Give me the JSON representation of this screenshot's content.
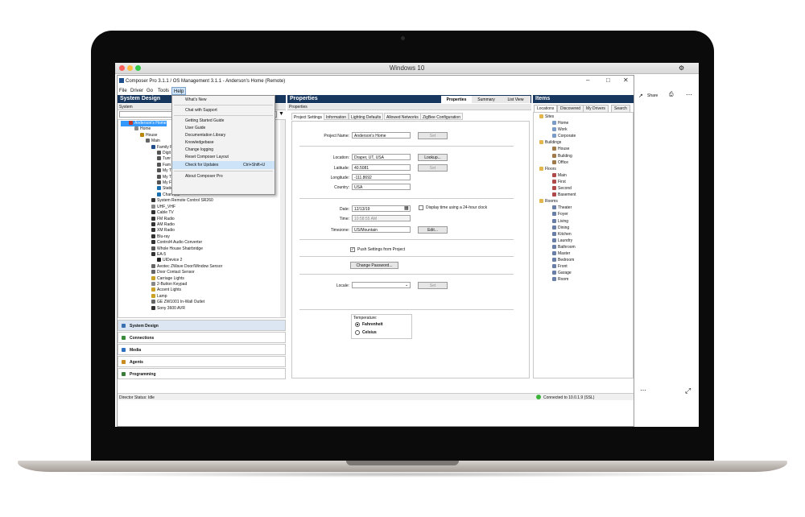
{
  "vm": {
    "title": "Windows 10",
    "toolbar": {
      "share": "Share"
    }
  },
  "app": {
    "title": "Composer Pro 3.1.1 / OS Management 3.1.1 - Anderson's Home (Remote)",
    "menu": [
      "File",
      "Driver",
      "Go",
      "Tools",
      "Help"
    ],
    "help_menu": {
      "items": [
        "What's New",
        "Chat with Support",
        "Getting Started Guide",
        "User Guide",
        "Documentation Library",
        "Knowledgebase",
        "Change logging",
        "Reset Composer Layout",
        "Check for Updates",
        "About Composer Pro"
      ],
      "shortcut": "Ctrl+Shift+U"
    },
    "system_design": {
      "title": "System Design",
      "subtitle": "System",
      "tree": [
        "Anderson's Home",
        "Home",
        "House",
        "Main",
        "Family R",
        "Digit",
        "Tunr",
        "Fam",
        "My T",
        "My T",
        "My F",
        "Stations",
        "Channels",
        "System Remote Control SR260",
        "UHF_VHF",
        "Cable TV",
        "FM Radio",
        "AM Radio",
        "XM Radio",
        "Blu-ray",
        "Control4 Audio Converter",
        "Whole House Shairbridge",
        "EA-5",
        "UIDevice 2",
        "Aeotec ZWave Door/Window Sensor",
        "Door Contact Sensor",
        "Carriage Lights",
        "2-Button Keypad",
        "Accent Lights",
        "Lamp",
        "GE ZW1001 In-Wall Outlet",
        "Sony 3600 AVR"
      ]
    },
    "nav": [
      "System Design",
      "Connections",
      "Media",
      "Agents",
      "Programming"
    ],
    "status": {
      "left": "Director Status: Idle",
      "right": "Connected to 10.0.1.9 (SSL)"
    },
    "properties": {
      "title": "Properties",
      "view_tabs": [
        "Properties",
        "Summary",
        "List View"
      ],
      "subtitle": "Properties",
      "tabs": [
        "Project Settings",
        "Information",
        "Lighting Defaults",
        "Allowed Networks",
        "ZigBee Configuration"
      ],
      "fields": {
        "project_name_label": "Project Name:",
        "project_name": "Anderson's Home",
        "set": "Set",
        "location_label": "Location:",
        "location": "Draper, UT, USA",
        "lookup": "Lookup...",
        "latitude_label": "Latitude:",
        "latitude": "40.5081",
        "longitude_label": "Longitude:",
        "longitude": "-111.8692",
        "country_label": "Country:",
        "country": "USA",
        "date_label": "Date:",
        "date": "12/13/19",
        "display24": "Display time using a 24-hour clock",
        "time_label": "Time:",
        "time": "10:58:55 AM",
        "timezone_label": "Timezone:",
        "timezone": "US/Mountain",
        "edit": "Edit...",
        "push": "Push Settings from Project",
        "change_password": "Change Password...",
        "locale_label": "Locale:",
        "temperature_label": "Temperature:",
        "fahrenheit": "Fahrenheit",
        "celsius": "Celsius"
      }
    },
    "items": {
      "title": "Items",
      "tabs": [
        "Locations",
        "Discovered",
        "My Drivers",
        "Search"
      ],
      "tree": [
        "Sites",
        "Home",
        "Work",
        "Corporate",
        "Buildings",
        "House",
        "Building",
        "Office",
        "Floors",
        "Main",
        "First",
        "Second",
        "Basement",
        "Rooms",
        "Theater",
        "Foyer",
        "Living",
        "Dining",
        "Kitchen",
        "Laundry",
        "Bathroom",
        "Master",
        "Bedroom",
        "Front",
        "Garage",
        "Room"
      ]
    }
  },
  "colors": {
    "panel_header": "#17375e",
    "accent": "#cde3f7"
  }
}
